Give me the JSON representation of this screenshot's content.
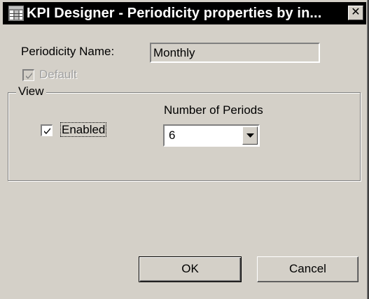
{
  "window": {
    "title": "KPI Designer - Periodicity properties by in...",
    "close_glyph": "✕",
    "icon": "app-grid-icon"
  },
  "form": {
    "periodicity_name_label": "Periodicity Name:",
    "periodicity_name_value": "Monthly",
    "default_label": "Default",
    "default_checked": true,
    "default_disabled": true
  },
  "view_group": {
    "legend": "View",
    "enabled_label": "Enabled",
    "enabled_checked": true,
    "number_of_periods_label": "Number of Periods",
    "number_of_periods_value": "6"
  },
  "buttons": {
    "ok_label": "OK",
    "cancel_label": "Cancel"
  },
  "colors": {
    "face": "#d4d0c8",
    "titlebar": "#000000",
    "title_text": "#ffffff",
    "disabled_text": "#a0a0a0"
  }
}
